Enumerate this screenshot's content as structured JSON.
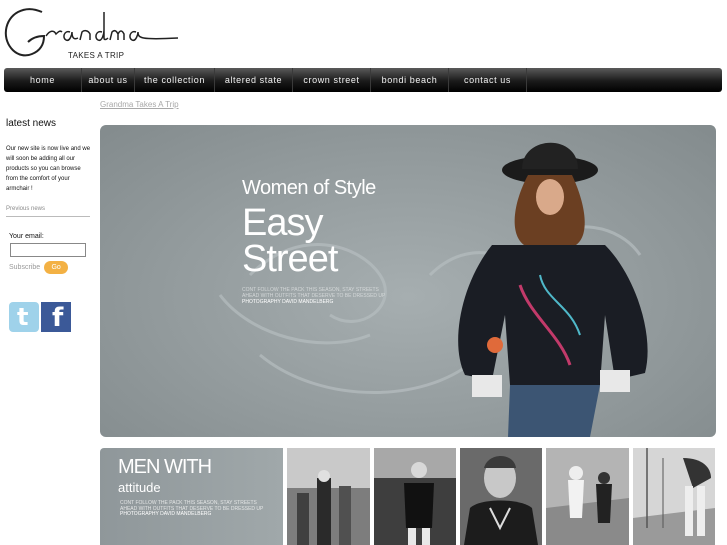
{
  "brand": {
    "logo_text": "Grandma",
    "tagline": "TAKES A TRIP"
  },
  "nav": [
    {
      "label": "home"
    },
    {
      "label": "about us"
    },
    {
      "label": "the collection"
    },
    {
      "label": "altered state"
    },
    {
      "label": "crown street"
    },
    {
      "label": "bondi beach"
    },
    {
      "label": "contact us"
    }
  ],
  "breadcrumb": "Grandma Takes A Trip",
  "sidebar": {
    "title": "latest news",
    "news": "Our new site is now live and we will soon be adding all our products so you can browse from the comfort of your armchair !",
    "previous": "Previous news",
    "email_label": "Your email:",
    "email_value": "",
    "subscribe": "Subscribe",
    "go": "Go"
  },
  "social": {
    "twitter": "t",
    "facebook": "f"
  },
  "hero": {
    "title": "Women of Style",
    "headline": "Easy Street",
    "small": "CONT FOLLOW THE PACK THIS SEASON, STAY STREETS AHEAD WITH OUTFITS THAT DESERVE TO BE DRESSED UP",
    "credit": "PHOTOGRAPHY DAVID MANDELBERG"
  },
  "men": {
    "title": "MEN WITH",
    "subtitle": "attitude",
    "small": "CONT FOLLOW THE PACK THIS SEASON, STAY STREETS AHEAD WITH OUTFITS THAT DESERVE TO BE DRESSED UP",
    "credit": "PHOTOGRAPHY DAVID MANDELBERG"
  }
}
